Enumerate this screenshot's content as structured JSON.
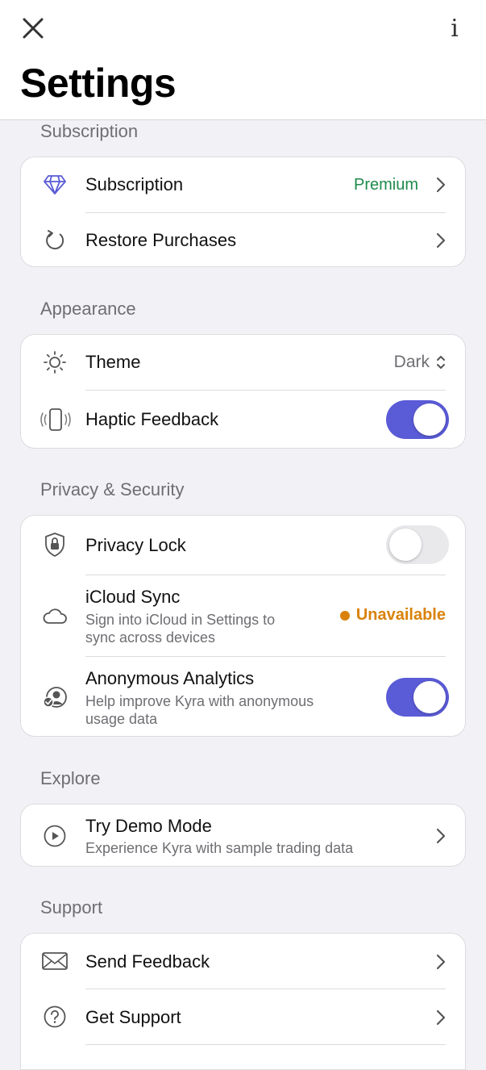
{
  "header": {
    "title": "Settings",
    "info_label": "i"
  },
  "sections": {
    "subscription": {
      "label": "Subscription",
      "rows": {
        "subscription": {
          "title": "Subscription",
          "value": "Premium"
        },
        "restore": {
          "title": "Restore Purchases"
        }
      }
    },
    "appearance": {
      "label": "Appearance",
      "rows": {
        "theme": {
          "title": "Theme",
          "value": "Dark"
        },
        "haptic": {
          "title": "Haptic Feedback",
          "enabled": true
        }
      }
    },
    "privacy": {
      "label": "Privacy & Security",
      "rows": {
        "lock": {
          "title": "Privacy Lock",
          "enabled": false
        },
        "icloud": {
          "title": "iCloud Sync",
          "subtitle_line1": "Sign into iCloud in Settings to",
          "subtitle_line2": "sync across devices",
          "status": "Unavailable"
        },
        "analytics": {
          "title": "Anonymous Analytics",
          "subtitle_line1": "Help improve Kyra with anonymous",
          "subtitle_line2": "usage data",
          "enabled": true
        }
      }
    },
    "explore": {
      "label": "Explore",
      "rows": {
        "demo": {
          "title": "Try Demo Mode",
          "subtitle": "Experience Kyra with sample trading data"
        }
      }
    },
    "support": {
      "label": "Support",
      "rows": {
        "feedback": {
          "title": "Send Feedback"
        },
        "support": {
          "title": "Get Support"
        }
      }
    }
  },
  "colors": {
    "accent": "#5a5bd6",
    "premium": "#1f8a4c",
    "warning": "#d9820a",
    "secondary_text": "#6e6e73"
  },
  "icons": {
    "close": "close-icon",
    "info": "info-icon",
    "subscription": "diamond-icon",
    "restore": "refresh-icon",
    "theme": "sun-icon",
    "haptic": "phone-vibrate-icon",
    "lock": "shield-lock-icon",
    "icloud": "cloud-icon",
    "analytics": "person-check-icon",
    "demo": "play-circle-icon",
    "feedback": "envelope-icon",
    "support": "question-circle-icon"
  }
}
